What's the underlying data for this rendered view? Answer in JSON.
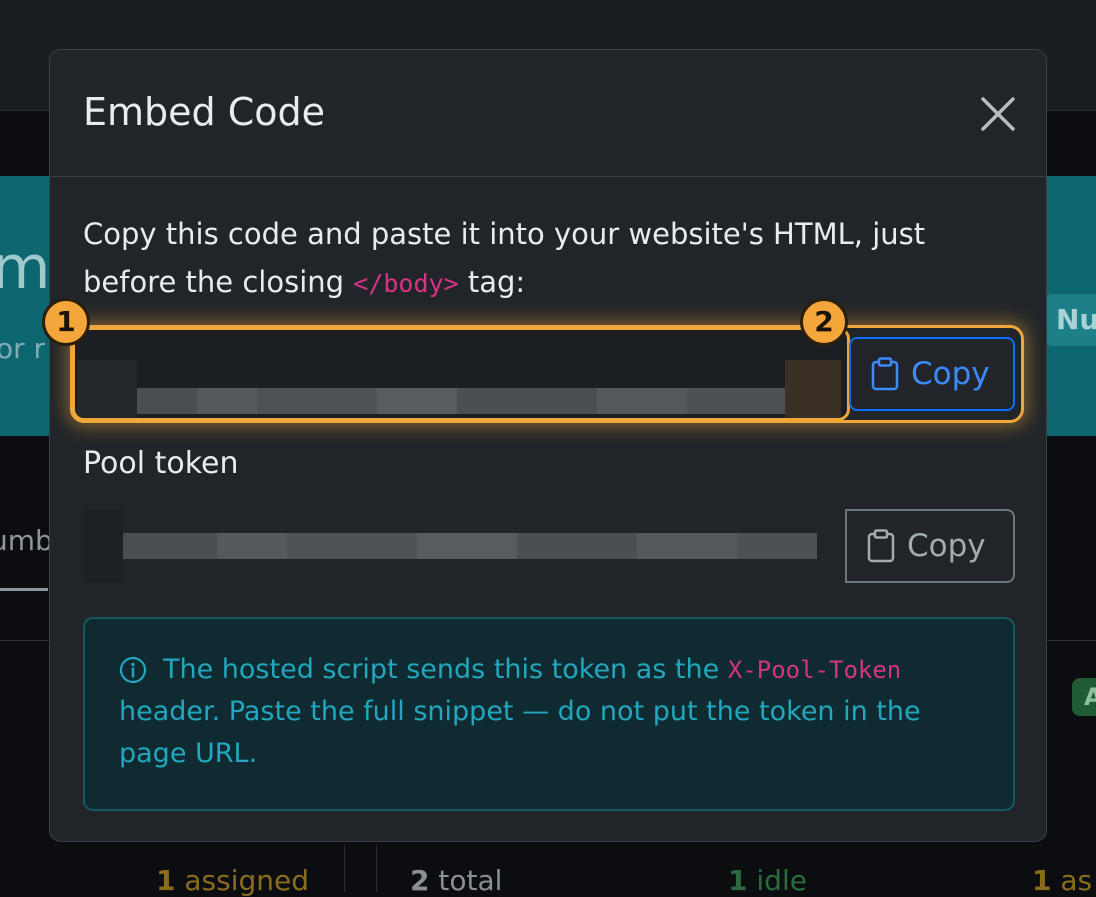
{
  "background": {
    "hero_title": "mb",
    "hero_subtitle": "or r",
    "hero_badge": "Nu",
    "tab_label": "umb",
    "status_pill": "A",
    "stats": [
      {
        "count": "1",
        "label": "assigned"
      },
      {
        "count": "2",
        "label": "total"
      },
      {
        "count": "1",
        "label": "idle"
      },
      {
        "count": "1",
        "label": "as"
      }
    ]
  },
  "modal": {
    "title": "Embed Code",
    "intro_before": "Copy this code and paste it into your website's HTML, just before the closing ",
    "intro_code": "</body>",
    "intro_after": " tag:",
    "embed_copy_label": "Copy",
    "pool_label": "Pool token",
    "pool_copy_label": "Copy",
    "info_before": "The hosted script sends this token as the ",
    "info_code": "X-Pool-Token",
    "info_after": " header. Paste the full snippet — do not put the token in the page URL.",
    "markers": [
      "1",
      "2"
    ]
  },
  "colors": {
    "accent": "#0d6efd",
    "highlight": "#f0a73a",
    "code": "#d63384",
    "info_text": "#22a7be"
  }
}
